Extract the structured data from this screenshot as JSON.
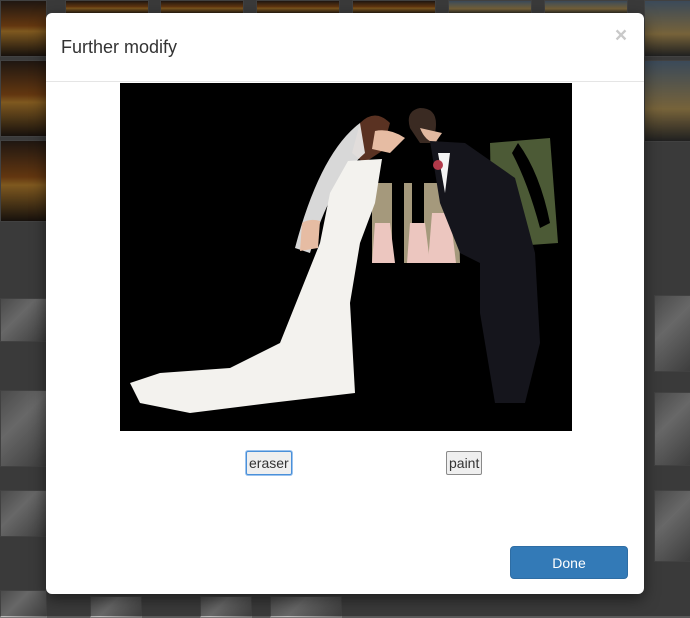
{
  "modal": {
    "title": "Further modify",
    "close_label": "×"
  },
  "tools": {
    "eraser_label": "eraser",
    "paint_label": "paint",
    "active_tool": "eraser"
  },
  "footer": {
    "done_label": "Done"
  },
  "colors": {
    "primary": "#337ab7",
    "canvas_background": "#000000"
  }
}
